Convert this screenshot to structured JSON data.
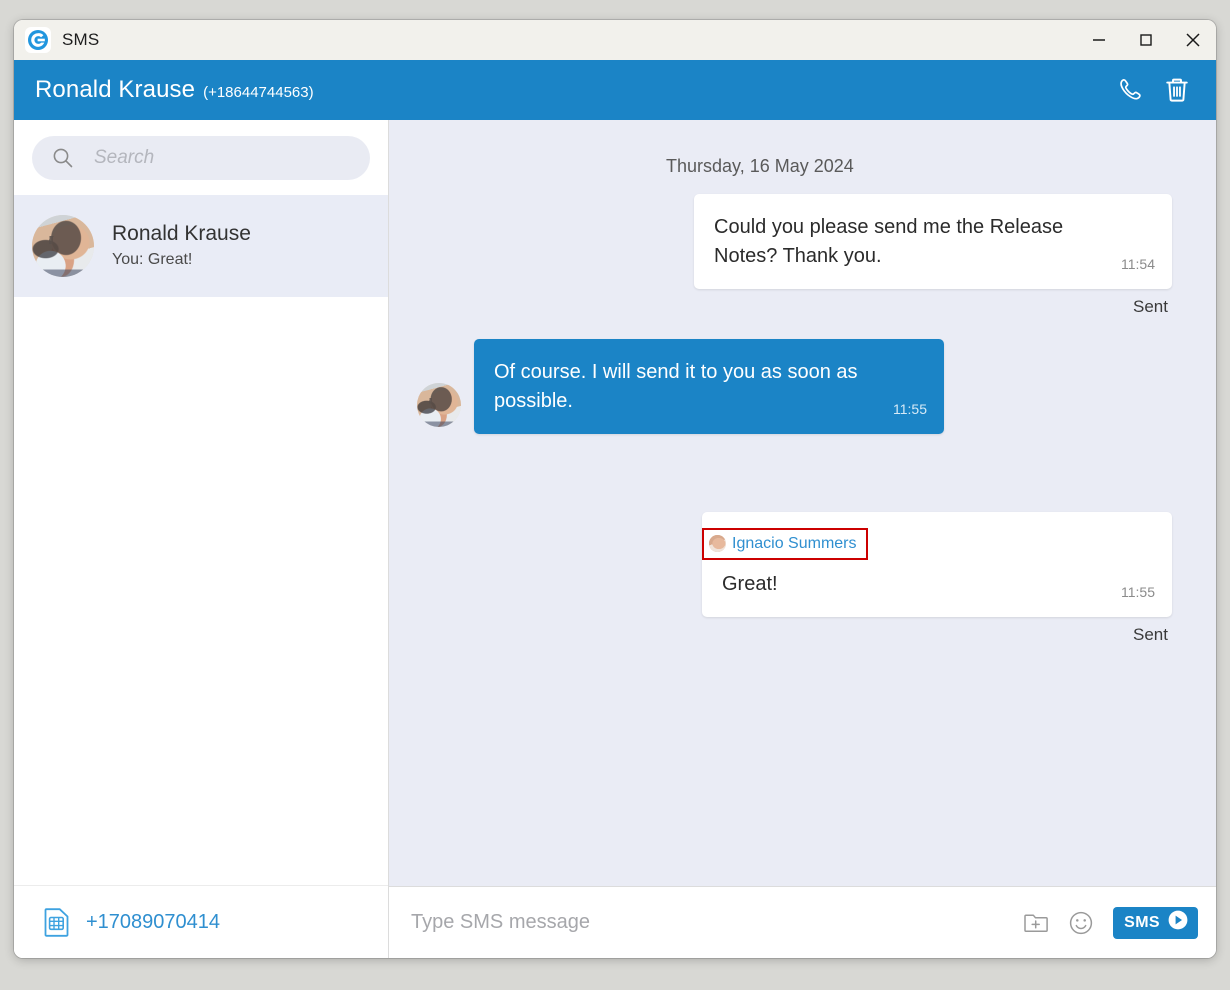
{
  "window": {
    "app_title": "SMS",
    "app_icon": "g-logo-icon",
    "controls": {
      "minimize": "minimize-icon",
      "maximize": "maximize-icon",
      "close": "close-icon"
    }
  },
  "header": {
    "contact_name": "Ronald Krause",
    "contact_phone": "(+18644744563)",
    "call_icon": "phone-icon",
    "delete_icon": "trash-icon",
    "background_color": "#1b84c6"
  },
  "sidebar": {
    "search": {
      "placeholder": "Search",
      "value": "",
      "icon": "search-icon"
    },
    "conversations": [
      {
        "name": "Ronald Krause",
        "preview": "You: Great!",
        "avatar": "contact-photo",
        "selected": true
      }
    ],
    "footer": {
      "sim_icon": "sim-card-icon",
      "phone_number": "+17089070414"
    }
  },
  "chat": {
    "date_separator": "Thursday, 16 May 2024",
    "messages": [
      {
        "direction": "outgoing",
        "text": "Could you please send me the Release Notes? Thank you.",
        "time": "11:54",
        "status": "Sent"
      },
      {
        "direction": "incoming",
        "text": "Of course. I will send it to you as soon as possible.",
        "time": "11:55",
        "avatar": "contact-photo"
      },
      {
        "direction": "outgoing",
        "sender_tag": "Ignacio Summers",
        "sender_avatar": "sender-photo",
        "text": "Great!",
        "time": "11:55",
        "status": "Sent",
        "highlight_color": "#cc0000"
      }
    ]
  },
  "composer": {
    "placeholder": "Type SMS message",
    "value": "",
    "attach_icon": "attach-folder-icon",
    "emoji_icon": "smiley-icon",
    "send_label": "SMS",
    "send_icon": "send-arrow-icon"
  }
}
